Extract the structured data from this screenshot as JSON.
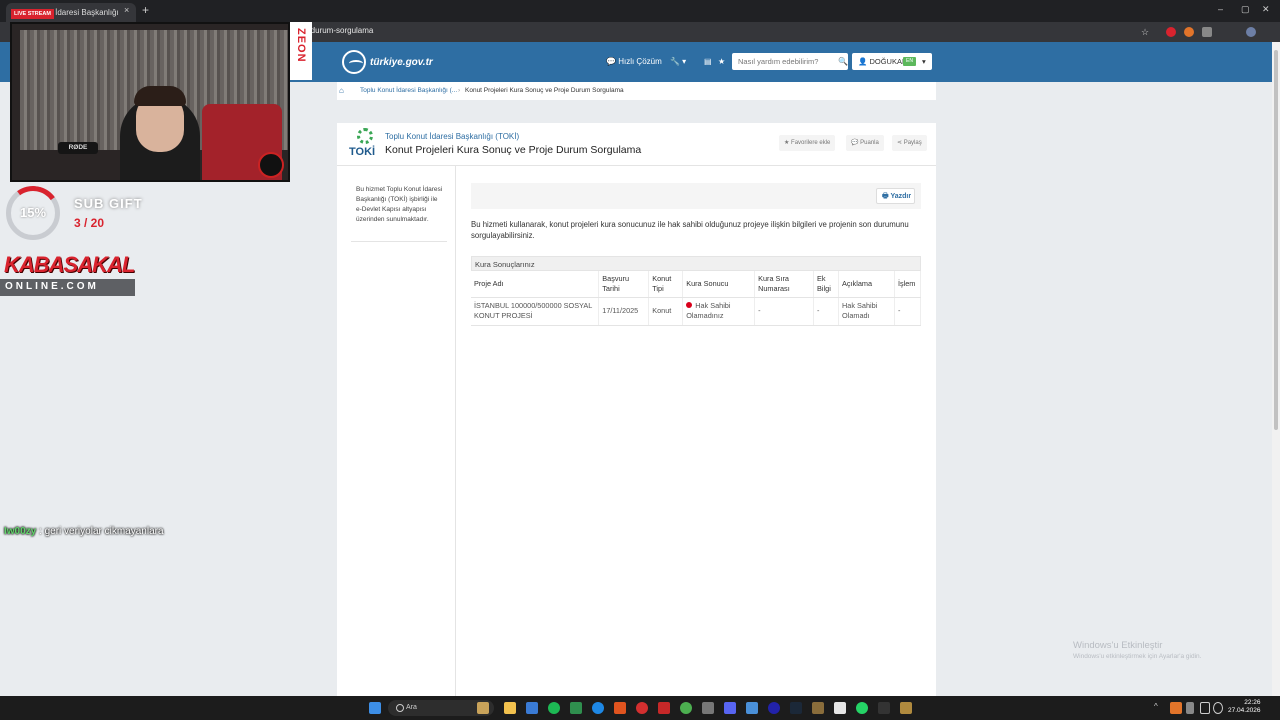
{
  "browser": {
    "tab_title": "Konut İdaresi Başkanlığı",
    "tab_close": "×",
    "new_tab": "+",
    "url": "-durum-sorgulama",
    "win_min": "–",
    "win_max": "▢",
    "win_close": "✕"
  },
  "header": {
    "logo_text": "türkiye.gov.tr",
    "quick_solution": "Hızlı Çözüm",
    "search_placeholder": "Nasıl yardım edebilirim?",
    "user_name": "DOĞUKAN",
    "user_badge": "EN"
  },
  "breadcrumb": {
    "item1": "Toplu Konut İdaresi Başkanlığı (...",
    "separator": "›",
    "item2": "Konut Projeleri Kura Sonuç ve Proje Durum Sorgulama"
  },
  "service": {
    "org": "Toplu Konut İdaresi Başkanlığı (TOKİ)",
    "title": "Konut Projeleri Kura Sonuç ve Proje Durum Sorgulama",
    "logo_word": "TOKİ",
    "actions": {
      "favorite": "Favorilere ekle",
      "rate": "Puanla",
      "share": "Paylaş"
    },
    "sidebar_info": "Bu hizmet Toplu Konut İdaresi Başkanlığı (TOKİ) işbirliği ile e-Devlet Kapısı altyapısı üzerinden sunulmaktadır.",
    "print_label": "Yazdır",
    "description": "Bu hizmeti kullanarak, konut projeleri kura sonucunuz ile hak sahibi olduğunuz projeye ilişkin bilgileri ve projenin son durumunu sorgulayabilirsiniz."
  },
  "results": {
    "caption": "Kura Sonuçlarınız",
    "columns": [
      "Proje Adı",
      "Başvuru Tarihi",
      "Konut Tipi",
      "Kura Sonucu",
      "Kura Sıra Numarası",
      "Ek Bilgi",
      "Açıklama",
      "İşlem"
    ],
    "rows": [
      {
        "project": "İSTANBUL 100000/500000 SOSYAL KONUT PROJESİ",
        "date": "17/11/2025",
        "type": "Konut",
        "result": "Hak Sahibi Olamadınız",
        "result_color": "#d9001b",
        "queue": "-",
        "extra": "-",
        "note": "Hak Sahibi Olamadı",
        "action": "-"
      }
    ]
  },
  "watermark": {
    "line1": "Windows'u Etkinleştir",
    "line2": "Windows'u etkinleştirmek için Ayarlar'a gidin."
  },
  "overlay": {
    "live_badge": "LIVE STREAM",
    "zeon": "ZEON",
    "mic_label": "RØDE",
    "goal_percent": "15%",
    "goal_fraction": 0.15,
    "sub_label": "SUB GIFT",
    "sub_count": "3 / 20",
    "brand_top": "KABASAKAL",
    "brand_bottom": "ONLINE.COM",
    "chat_user": "Iw00zy",
    "chat_message": ": geri veriyolar cikmayanlara"
  },
  "taskbar": {
    "search": "Ara",
    "time": "22:26",
    "date": "27.04.2026"
  }
}
